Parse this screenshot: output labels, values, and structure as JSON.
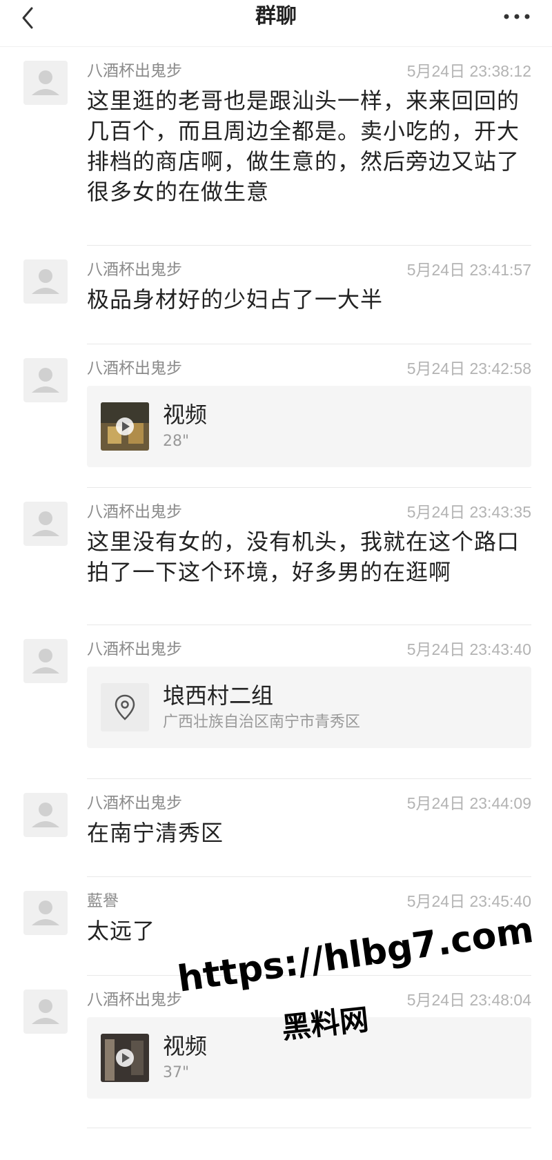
{
  "header": {
    "title": "群聊",
    "back_icon": "chevron-left-icon",
    "more_icon": "more-dots-icon"
  },
  "messages": [
    {
      "sender": "八酒杯出鬼步",
      "time": "5月24日 23:38:12",
      "type": "text",
      "text": "这里逛的老哥也是跟汕头一样，来来回回的几百个，而且周边全都是。卖小吃的，开大排档的商店啊，做生意的，然后旁边又站了很多女的在做生意"
    },
    {
      "sender": "八酒杯出鬼步",
      "time": "5月24日 23:41:57",
      "type": "text",
      "text": "极品身材好的少妇占了一大半"
    },
    {
      "sender": "八酒杯出鬼步",
      "time": "5月24日 23:42:58",
      "type": "video",
      "title": "视频",
      "duration": "28\""
    },
    {
      "sender": "八酒杯出鬼步",
      "time": "5月24日 23:43:35",
      "type": "text",
      "text": "这里没有女的，没有机头，我就在这个路口拍了一下这个环境，好多男的在逛啊"
    },
    {
      "sender": "八酒杯出鬼步",
      "time": "5月24日 23:43:40",
      "type": "location",
      "title": "埌西村二组",
      "address": "广西壮族自治区南宁市青秀区"
    },
    {
      "sender": "八酒杯出鬼步",
      "time": "5月24日 23:44:09",
      "type": "text",
      "text": "在南宁清秀区"
    },
    {
      "sender": "藍譽",
      "time": "5月24日 23:45:40",
      "type": "text",
      "text": "太远了"
    },
    {
      "sender": "八酒杯出鬼步",
      "time": "5月24日 23:48:04",
      "type": "video",
      "title": "视频",
      "duration": "37\""
    }
  ],
  "watermark": {
    "line1": "https://hlbg7.com",
    "line2": "黑料网"
  }
}
